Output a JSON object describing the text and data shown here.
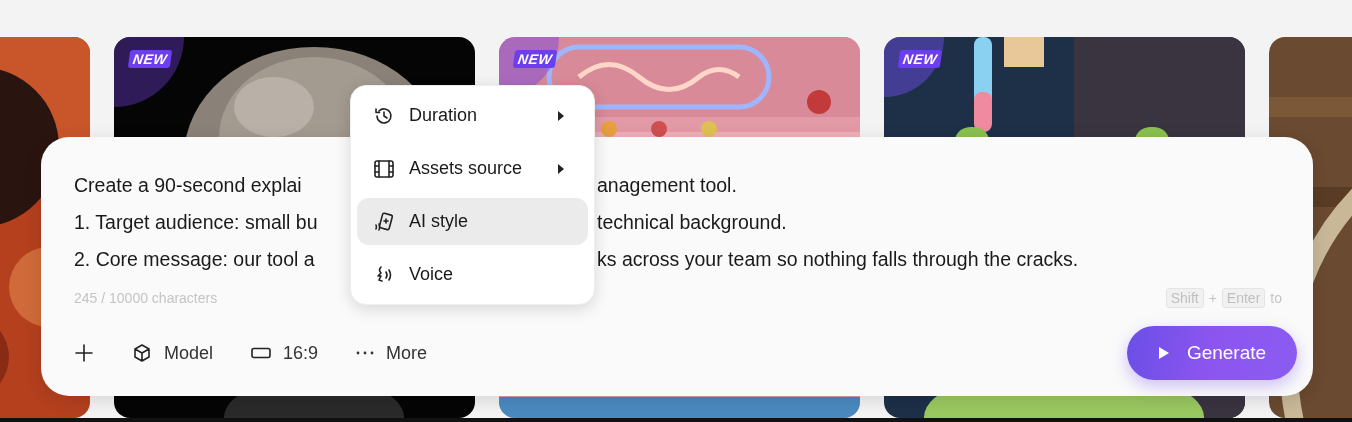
{
  "cards": [
    {
      "kind": "picture"
    },
    {
      "kind": "picture",
      "badge": "NEW"
    },
    {
      "kind": "picture",
      "badge": "NEW"
    },
    {
      "kind": "picture",
      "badge": "NEW"
    },
    {
      "kind": "picture"
    }
  ],
  "prompt": {
    "lines": [
      {
        "left": "Create a 90-second explai",
        "right": "anagement tool."
      },
      {
        "left": "1. Target audience: small bu",
        "right": "technical background."
      },
      {
        "left": "2. Core message: our tool a",
        "right": "ks across your team so nothing falls through the cracks."
      }
    ],
    "counter": "245 / 10000 characters",
    "hint": {
      "keys": [
        "Shift",
        "Enter"
      ],
      "joiner": "+",
      "tail": "to"
    }
  },
  "toolbar": {
    "buttons": [
      {
        "label": "Model"
      },
      {
        "label": "16:9"
      },
      {
        "label": "More"
      }
    ]
  },
  "generate_button": {
    "label": "Generate"
  },
  "more_menu": {
    "items": [
      {
        "label": "Duration",
        "submenu": true,
        "selected": false
      },
      {
        "label": "Assets source",
        "submenu": true,
        "selected": false
      },
      {
        "label": "AI style",
        "submenu": false,
        "selected": true
      },
      {
        "label": "Voice",
        "submenu": false,
        "selected": false
      }
    ]
  }
}
